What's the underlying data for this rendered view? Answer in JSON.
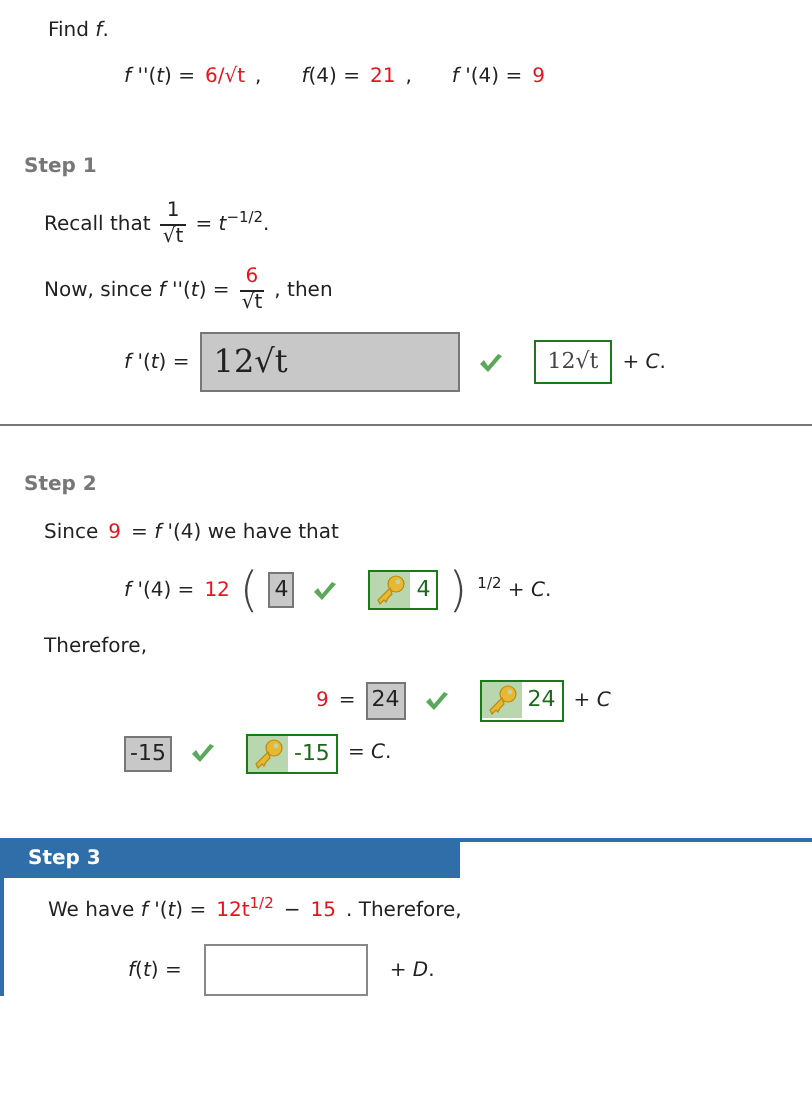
{
  "problem": {
    "prompt": "Find *f*.",
    "given": [
      {
        "kind": "text",
        "text": "*f* ''(*t*) ="
      },
      {
        "kind": "given",
        "text": "6/√t"
      },
      {
        "kind": "text",
        "text": ","
      },
      {
        "kind": "gap"
      },
      {
        "kind": "text",
        "text": "*f*(4) ="
      },
      {
        "kind": "given",
        "text": "21"
      },
      {
        "kind": "text",
        "text": ","
      },
      {
        "kind": "gap"
      },
      {
        "kind": "text",
        "text": "*f* '(4) ="
      },
      {
        "kind": "given",
        "text": "9"
      }
    ]
  },
  "steps": [
    {
      "title": "Step 1",
      "active": false,
      "lines": [
        {
          "kind": "prose",
          "segments": [
            {
              "kind": "text",
              "text": "Recall that"
            },
            {
              "kind": "frac",
              "num": "1",
              "num_given": false,
              "den": "√t"
            },
            {
              "kind": "text",
              "text": "= *t*$^{−1/2}$."
            }
          ]
        },
        {
          "kind": "prose",
          "segments": [
            {
              "kind": "text",
              "text": "Now, since *f* ''(*t*) ="
            },
            {
              "kind": "frac",
              "num": "6",
              "num_given": true,
              "den": "√t"
            },
            {
              "kind": "text",
              "text": ", then"
            }
          ]
        },
        {
          "kind": "formula",
          "segments": [
            {
              "kind": "text",
              "text": "*f* '(*t*) ="
            },
            {
              "kind": "answer",
              "value": "12√t",
              "correct": true
            },
            {
              "kind": "solution",
              "value": "12√t",
              "key": false
            },
            {
              "kind": "text",
              "text": "+ *C*."
            }
          ]
        }
      ]
    },
    {
      "title": "Step 2",
      "active": false,
      "lines": [
        {
          "kind": "prose",
          "segments": [
            {
              "kind": "text",
              "text": "Since"
            },
            {
              "kind": "given",
              "text": "9"
            },
            {
              "kind": "text",
              "text": "= *f* '(4)  we have that"
            }
          ]
        },
        {
          "kind": "formula",
          "segments": [
            {
              "kind": "text",
              "text": "*f* '(4) ="
            },
            {
              "kind": "given",
              "text": "12"
            },
            {
              "kind": "paren",
              "text": "("
            },
            {
              "kind": "answer",
              "value": "4",
              "correct": true
            },
            {
              "kind": "solution",
              "value": "4",
              "key": true
            },
            {
              "kind": "paren",
              "text": ")"
            },
            {
              "kind": "text",
              "text": "$^{1/2}$ + *C*."
            }
          ]
        },
        {
          "kind": "prose",
          "segments": [
            {
              "kind": "text",
              "text": "Therefore,"
            }
          ]
        },
        {
          "kind": "centered",
          "segments": [
            {
              "kind": "given",
              "text": "9"
            },
            {
              "kind": "text",
              "text": "="
            },
            {
              "kind": "answer",
              "value": "24",
              "correct": true
            },
            {
              "kind": "solution",
              "value": "24",
              "key": true
            },
            {
              "kind": "text",
              "text": "+ *C*"
            }
          ]
        },
        {
          "kind": "formula",
          "segments": [
            {
              "kind": "answer",
              "value": "-15",
              "correct": true
            },
            {
              "kind": "solution",
              "value": "-15",
              "key": true
            },
            {
              "kind": "text",
              "text": "= *C*."
            }
          ]
        }
      ]
    },
    {
      "title": "Step 3",
      "active": true,
      "lines": [
        {
          "kind": "prose",
          "segments": [
            {
              "kind": "text",
              "text": "We have *f* '(*t*) ="
            },
            {
              "kind": "given",
              "text": "12t$^{1/2}$"
            },
            {
              "kind": "text",
              "text": "−"
            },
            {
              "kind": "given",
              "text": "15"
            },
            {
              "kind": "text",
              "text": ". Therefore,"
            }
          ]
        },
        {
          "kind": "formula",
          "segments": [
            {
              "kind": "text",
              "text": "*f*(*t*) ="
            },
            {
              "kind": "blank"
            },
            {
              "kind": "text",
              "text": "+ *D*."
            }
          ]
        }
      ]
    }
  ]
}
